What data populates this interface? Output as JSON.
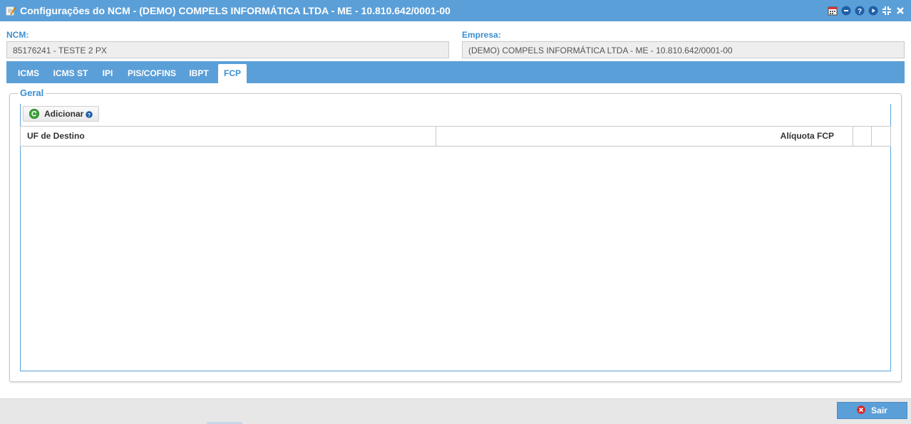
{
  "window": {
    "title": "Configurações do NCM - (DEMO) COMPELS INFORMÁTICA LTDA - ME - 10.810.642/0001-00",
    "tools": [
      "calendar-icon",
      "minimize-icon",
      "help-icon",
      "play-icon",
      "collapse-icon",
      "close-icon"
    ]
  },
  "fields": {
    "ncm_label": "NCM:",
    "ncm_value": "85176241 - TESTE 2 PX",
    "empresa_label": "Empresa:",
    "empresa_value": "(DEMO) COMPELS INFORMÁTICA LTDA - ME - 10.810.642/0001-00"
  },
  "tabs": [
    {
      "label": "ICMS"
    },
    {
      "label": "ICMS ST"
    },
    {
      "label": "IPI"
    },
    {
      "label": "PIS/COFINS"
    },
    {
      "label": "IBPT"
    },
    {
      "label": "FCP",
      "active": true
    }
  ],
  "section": {
    "legend": "Geral",
    "add_label": "Adicionar"
  },
  "grid": {
    "columns": [
      "UF de Destino",
      "Alíquota FCP"
    ],
    "rows": []
  },
  "footer": {
    "exit_label": "Sair"
  },
  "colors": {
    "accent": "#5b9fd8",
    "label": "#3b8fd0"
  }
}
